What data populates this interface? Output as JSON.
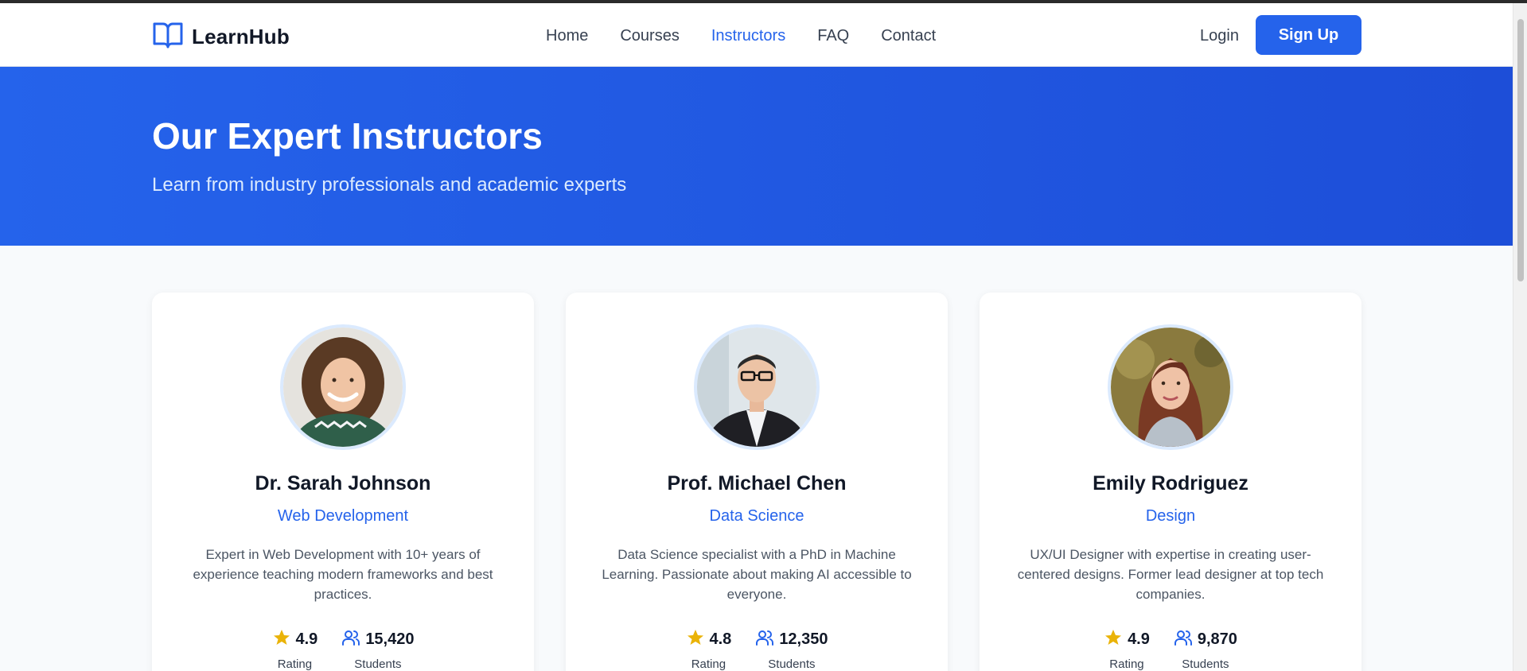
{
  "brand": {
    "name": "LearnHub",
    "icon": "book-icon",
    "color": "#2563eb"
  },
  "nav": {
    "items": [
      {
        "label": "Home",
        "active": false
      },
      {
        "label": "Courses",
        "active": false
      },
      {
        "label": "Instructors",
        "active": true
      },
      {
        "label": "FAQ",
        "active": false
      },
      {
        "label": "Contact",
        "active": false
      }
    ],
    "login_label": "Login",
    "signup_label": "Sign Up"
  },
  "hero": {
    "title": "Our Expert Instructors",
    "subtitle": "Learn from industry professionals and academic experts"
  },
  "instructors": [
    {
      "name": "Dr. Sarah Johnson",
      "specialty": "Web Development",
      "bio": "Expert in Web Development with 10+ years of experience teaching modern frameworks and best practices.",
      "rating": "4.9",
      "rating_label": "Rating",
      "students": "15,420",
      "students_label": "Students"
    },
    {
      "name": "Prof. Michael Chen",
      "specialty": "Data Science",
      "bio": "Data Science specialist with a PhD in Machine Learning. Passionate about making AI accessible to everyone.",
      "rating": "4.8",
      "rating_label": "Rating",
      "students": "12,350",
      "students_label": "Students"
    },
    {
      "name": "Emily Rodriguez",
      "specialty": "Design",
      "bio": "UX/UI Designer with expertise in creating user-centered designs. Former lead designer at top tech companies.",
      "rating": "4.9",
      "rating_label": "Rating",
      "students": "9,870",
      "students_label": "Students"
    }
  ],
  "colors": {
    "primary": "#2563eb",
    "star": "#eab308",
    "text": "#111827"
  }
}
